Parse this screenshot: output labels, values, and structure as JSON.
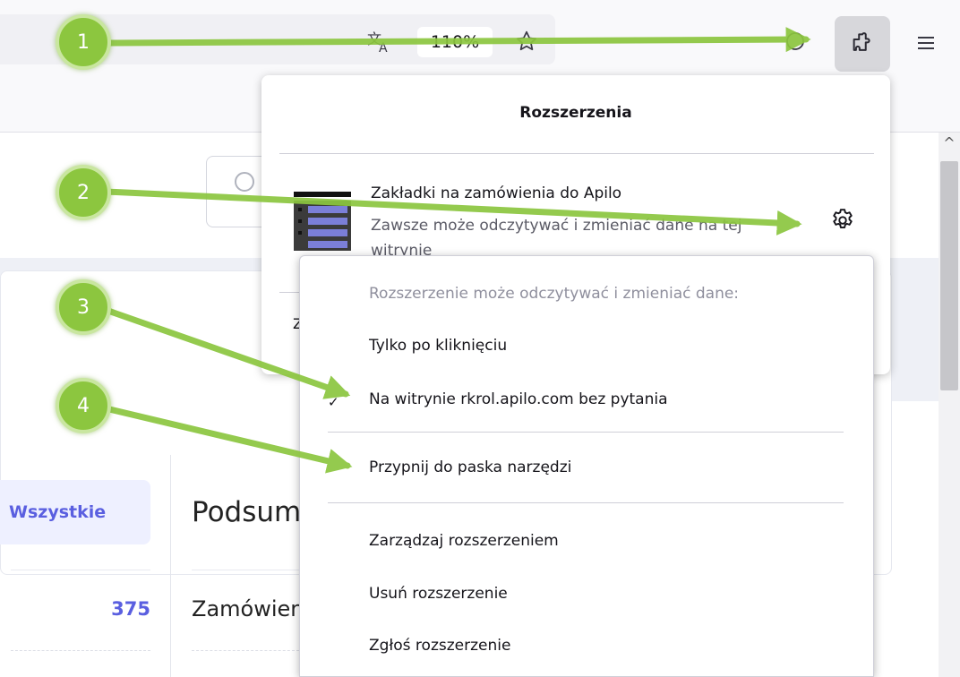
{
  "toolbar": {
    "zoom_label": "110%",
    "translate_icon": "translate-icon",
    "bookmark_icon": "star-icon",
    "extensions_icon": "puzzle-icon",
    "menu_icon": "hamburger-menu-icon"
  },
  "extensions_panel": {
    "title": "Rozszerzenia",
    "extension": {
      "name": "Zakładki na zamówienia do Apilo",
      "description": "Zawsze może odczytywać i zmieniać dane na tej witrynie",
      "settings_icon": "gear-icon"
    },
    "next_item_stub": "Z"
  },
  "context_menu": {
    "heading": "Rozszerzenie może odczytywać i zmieniać dane:",
    "option_click": "Tylko po kliknięciu",
    "option_site": "Na witrynie rkrol.apilo.com bez pytania",
    "pin": "Przypnij do paska narzędzi",
    "manage": "Zarządzaj rozszerzeniem",
    "remove": "Usuń rozszerzenie",
    "report": "Zgłoś rozszerzenie"
  },
  "page": {
    "tab_all": "Wszystkie",
    "summary_title": "Podsumowanie",
    "count": "375",
    "orders_label": "Zamówienia"
  },
  "annotations": {
    "badges": [
      "1",
      "2",
      "3",
      "4"
    ],
    "color": "#8cc63f"
  }
}
